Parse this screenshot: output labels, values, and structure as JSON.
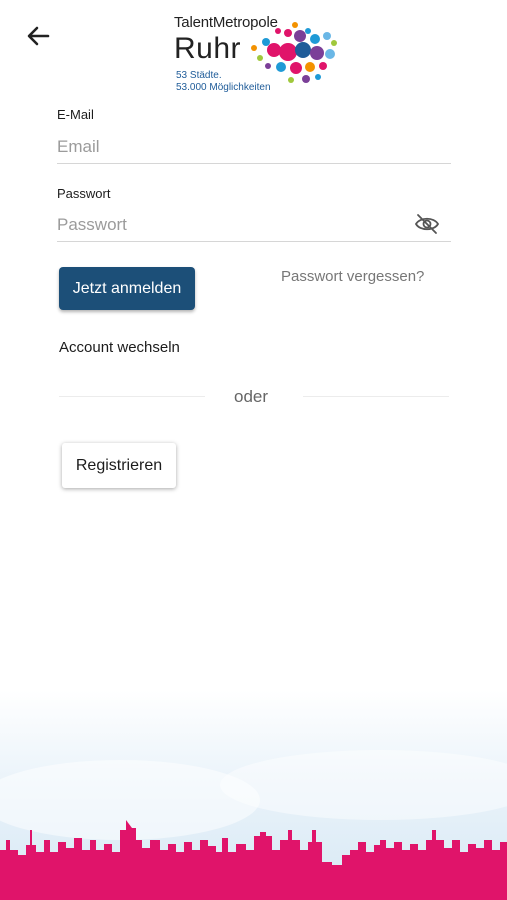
{
  "header": {
    "back_icon": "arrow-left-icon",
    "logo": {
      "line1": "TalentMetropole",
      "line2": "Ruhr",
      "tagline1": "53 Städte.",
      "tagline2": "53.000 Möglichkeiten"
    }
  },
  "form": {
    "email": {
      "label": "E-Mail",
      "placeholder": "Email",
      "value": ""
    },
    "password": {
      "label": "Passwort",
      "placeholder": "Passwort",
      "value": "",
      "toggle_icon": "eye-off-icon"
    },
    "login_label": "Jetzt anmelden",
    "forgot_label": "Passwort vergessen?",
    "switch_account_label": "Account wechseln",
    "divider_label": "oder",
    "register_label": "Registrieren"
  },
  "colors": {
    "primary": "#1c4f78",
    "skyline": "#e0146a",
    "logo_text_blue": "#1f5c99"
  }
}
